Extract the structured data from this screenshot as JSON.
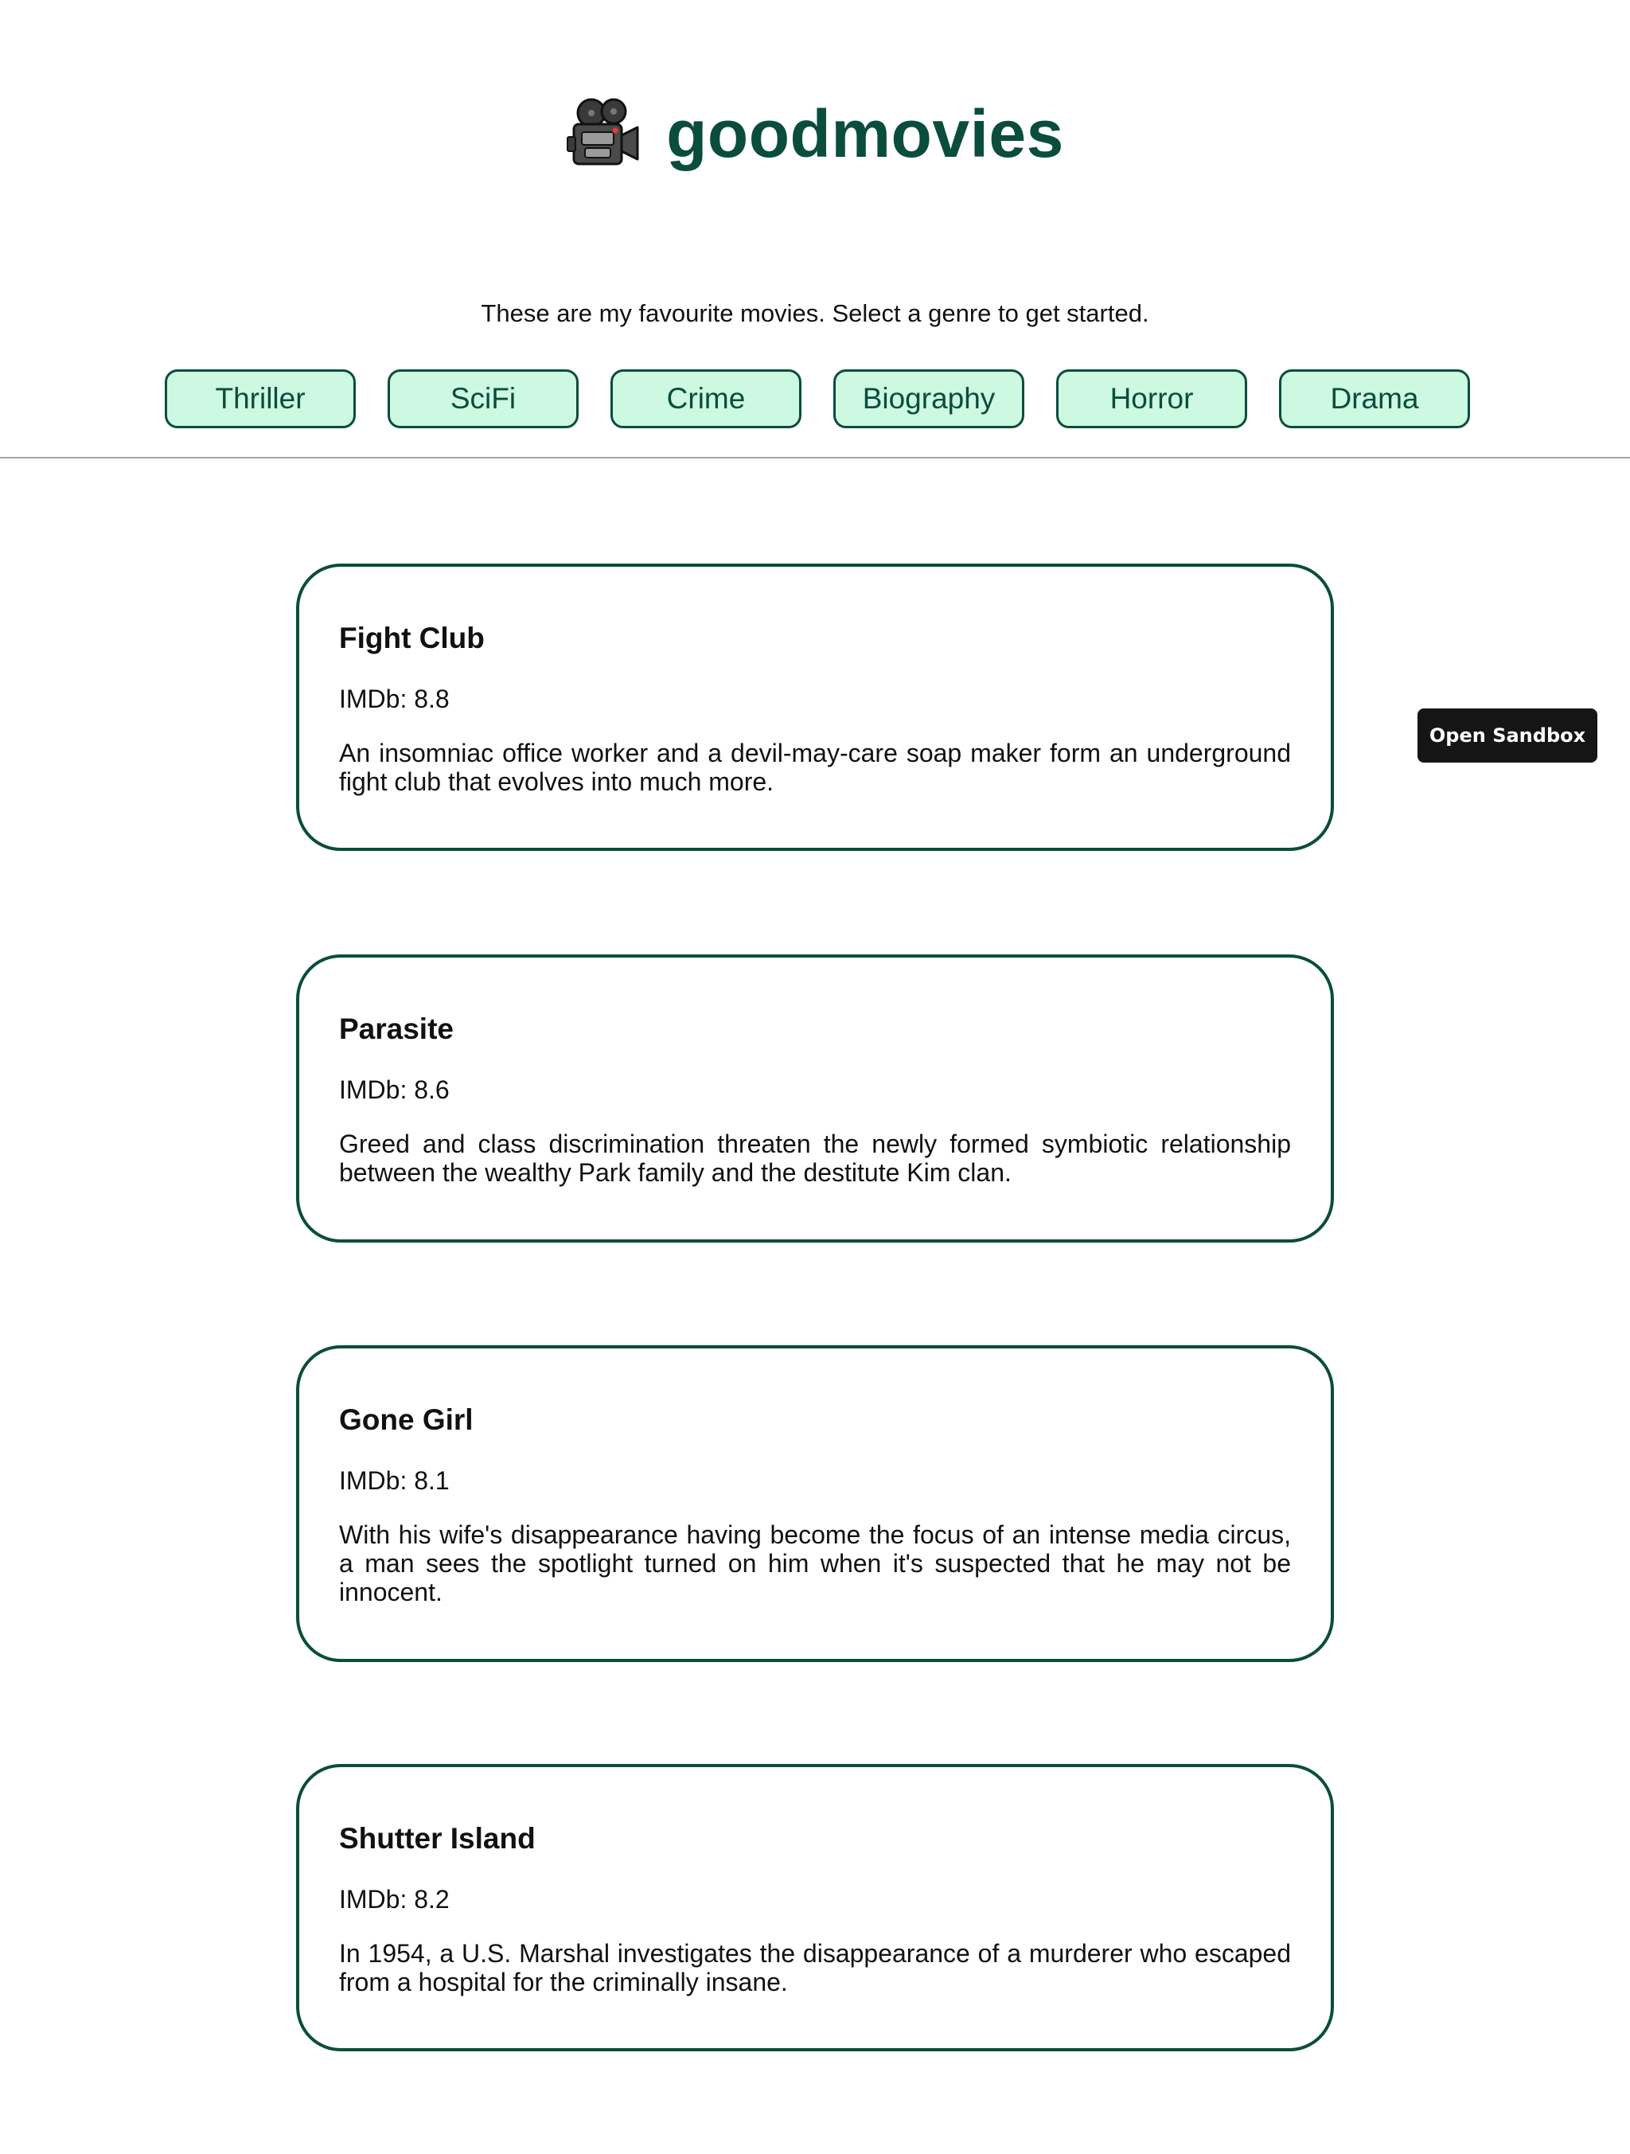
{
  "header": {
    "icon": "movie-camera-icon",
    "title": "goodmovies"
  },
  "tagline": "These are my favourite movies. Select a genre to get started.",
  "genres": [
    "Thriller",
    "SciFi",
    "Crime",
    "Biography",
    "Horror",
    "Drama"
  ],
  "movies": [
    {
      "title": "Fight Club",
      "rating": "IMDb: 8.8",
      "description": "An insomniac office worker and a devil-may-care soap maker form an underground fight club that evolves into much more."
    },
    {
      "title": "Parasite",
      "rating": "IMDb: 8.6",
      "description": "Greed and class discrimination threaten the newly formed symbiotic relationship between the wealthy Park family and the destitute Kim clan."
    },
    {
      "title": "Gone Girl",
      "rating": "IMDb: 8.1",
      "description": "With his wife's disappearance having become the focus of an intense media circus, a man sees the spotlight turned on him when it's suspected that he may not be innocent."
    },
    {
      "title": "Shutter Island",
      "rating": "IMDb: 8.2",
      "description": "In 1954, a U.S. Marshal investigates the disappearance of a murderer who escaped from a hospital for the criminally insane."
    }
  ],
  "sandbox_button": "Open Sandbox",
  "colors": {
    "brand": "#0a4d3d",
    "genre_bg": "#cdf8e1",
    "divider": "#a6a6a6",
    "sandbox_bg": "#151515"
  }
}
